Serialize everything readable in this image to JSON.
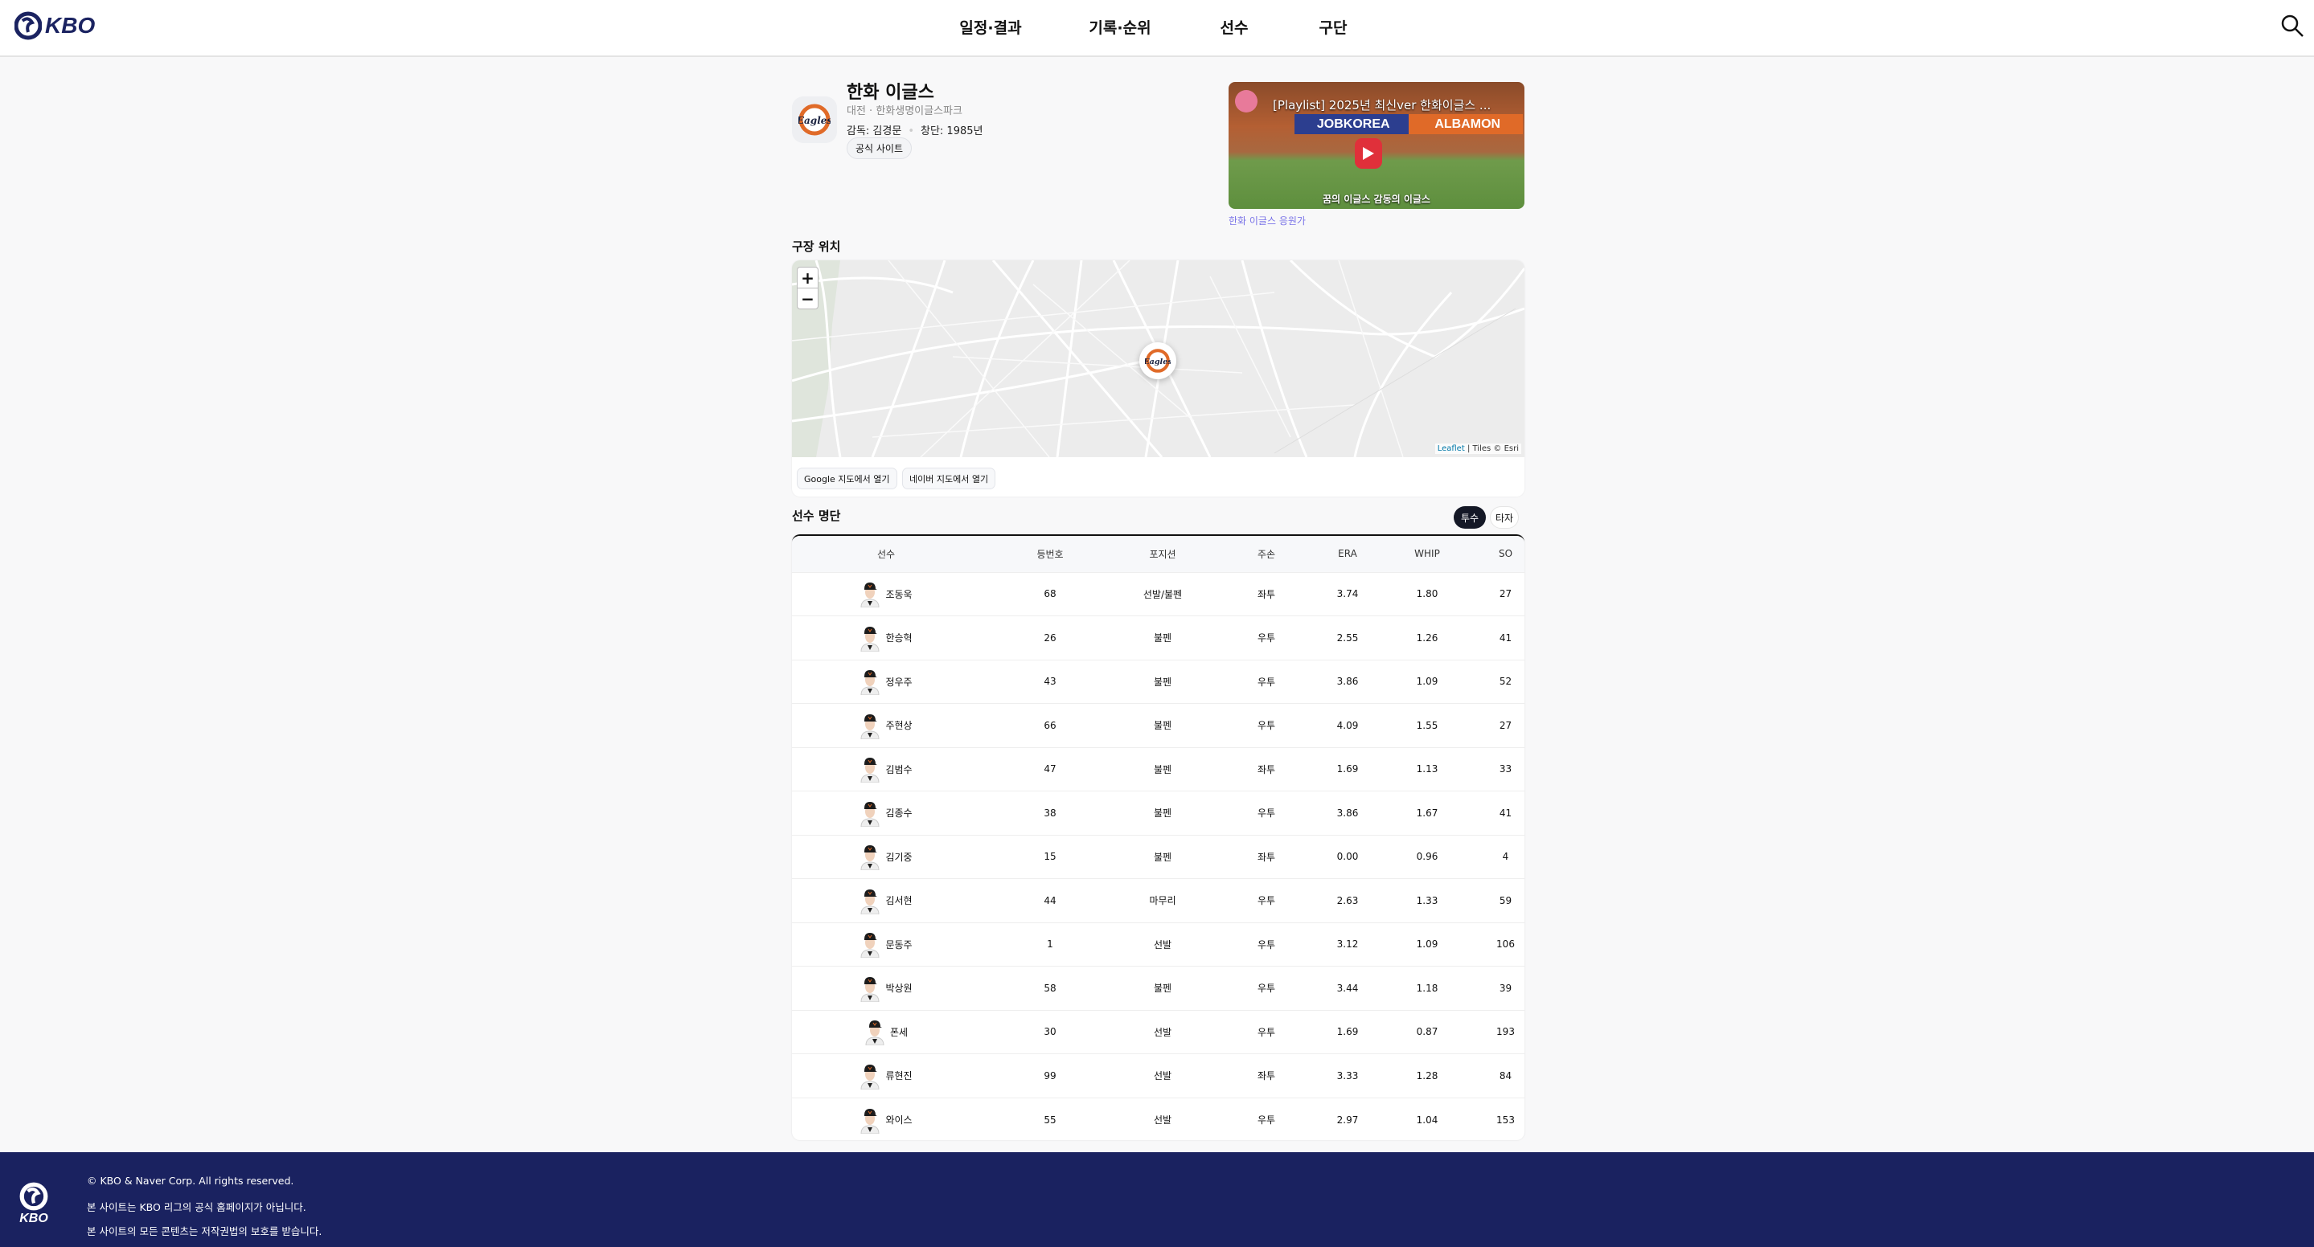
{
  "header": {
    "logo_text": "KBO",
    "nav": [
      "일정·결과",
      "기록·순위",
      "선수",
      "구단"
    ],
    "search_icon": "search-icon"
  },
  "team": {
    "name": "한화 이글스",
    "location": "대전 · 한화생명이글스파크",
    "manager": "감독: 김경문",
    "founded": "창단: 1985년",
    "official_site": "공식 사이트",
    "logo_text": "Eagles",
    "brand_color": "#e06a28"
  },
  "video": {
    "title": "[Playlist] 2025년 최신ver 한화이글스 ...",
    "banner_left": "JOBKOREA",
    "banner_right": "ALBAMON",
    "subtitle": "꿈의 이글스 감동의 이글스",
    "caption": "한화 이글스 응원가"
  },
  "map_section": {
    "title": "구장 위치",
    "zoom_in": "+",
    "zoom_out": "−",
    "attribution_link": "Leaflet",
    "attribution_rest": "| Tiles © Esri",
    "google_btn": "Google 지도에서 열기",
    "naver_btn": "네이버 지도에서 열기"
  },
  "roster": {
    "title": "선수 명단",
    "tabs": [
      "투수",
      "타자"
    ],
    "active_tab": "투수",
    "columns": [
      "선수",
      "등번호",
      "포지션",
      "주손",
      "ERA",
      "WHIP",
      "SO"
    ],
    "rows": [
      [
        "조동욱",
        "68",
        "선발/불펜",
        "좌투",
        "3.74",
        "1.80",
        "27"
      ],
      [
        "한승혁",
        "26",
        "불펜",
        "우투",
        "2.55",
        "1.26",
        "41"
      ],
      [
        "정우주",
        "43",
        "불펜",
        "우투",
        "3.86",
        "1.09",
        "52"
      ],
      [
        "주현상",
        "66",
        "불펜",
        "우투",
        "4.09",
        "1.55",
        "27"
      ],
      [
        "김범수",
        "47",
        "불펜",
        "좌투",
        "1.69",
        "1.13",
        "33"
      ],
      [
        "김종수",
        "38",
        "불펜",
        "우투",
        "3.86",
        "1.67",
        "41"
      ],
      [
        "김기중",
        "15",
        "불펜",
        "좌투",
        "0.00",
        "0.96",
        "4"
      ],
      [
        "김서현",
        "44",
        "마무리",
        "우투",
        "2.63",
        "1.33",
        "59"
      ],
      [
        "문동주",
        "1",
        "선발",
        "우투",
        "3.12",
        "1.09",
        "106"
      ],
      [
        "박상원",
        "58",
        "불펜",
        "우투",
        "3.44",
        "1.18",
        "39"
      ],
      [
        "폰세",
        "30",
        "선발",
        "우투",
        "1.69",
        "0.87",
        "193"
      ],
      [
        "류현진",
        "99",
        "선발",
        "좌투",
        "3.33",
        "1.28",
        "84"
      ],
      [
        "와이스",
        "55",
        "선발",
        "우투",
        "2.97",
        "1.04",
        "153"
      ]
    ]
  },
  "footer": {
    "logo_text": "KBO",
    "lines": [
      "© KBO & Naver Corp. All rights reserved.",
      "본 사이트는 KBO 리그의 공식 홈페이지가 아닙니다.",
      "본 사이트의 모든 콘텐츠는 저작권법의 보호를 받습니다."
    ],
    "bg_color": "#1a2260"
  }
}
